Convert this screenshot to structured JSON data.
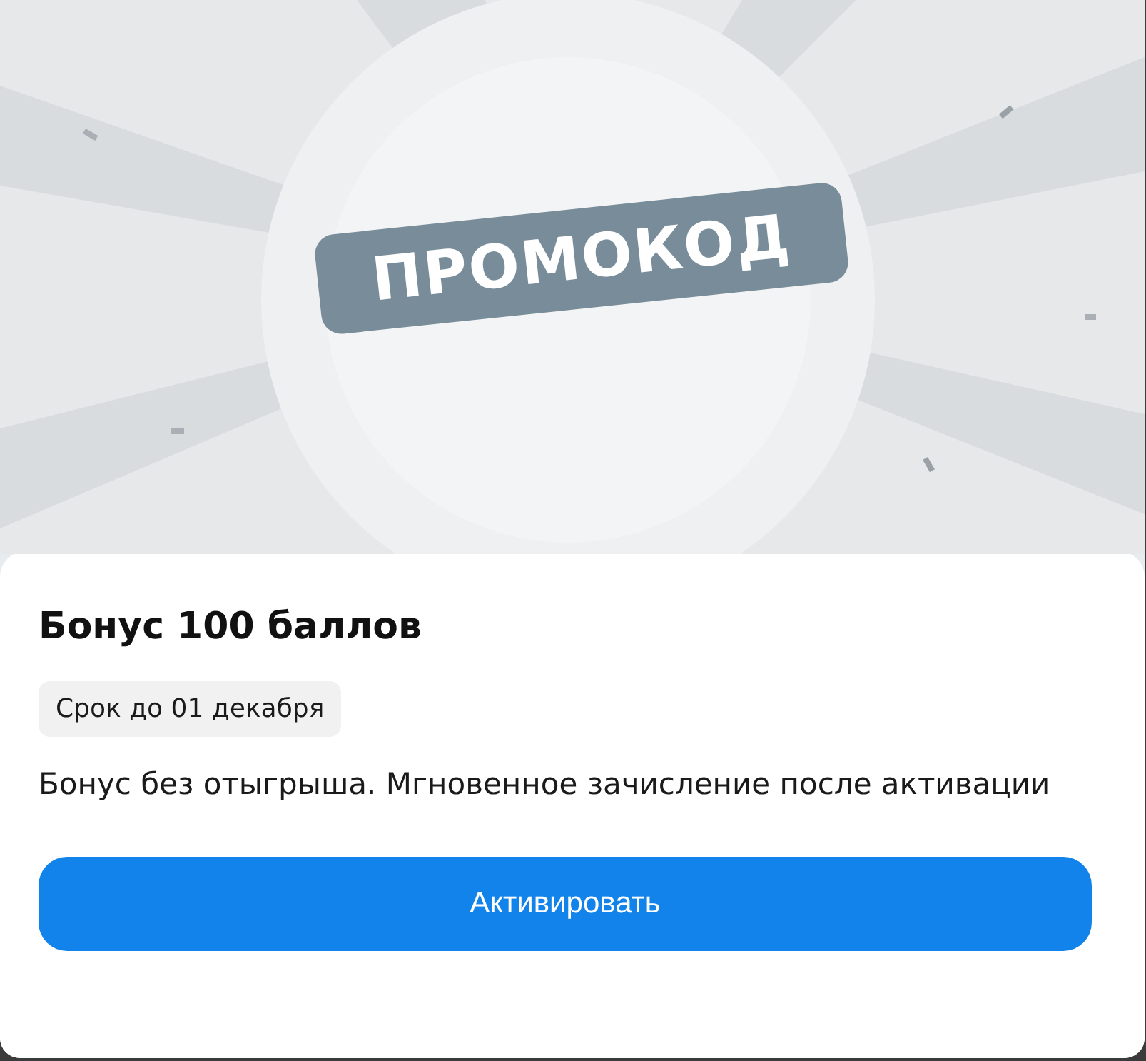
{
  "banner": {
    "kind": "picture",
    "badge": "ПРОМОКОД"
  },
  "offer": {
    "title": "Бонус 100 баллов",
    "expiry": "Срок до 01 декабря",
    "description": "Бонус без отыгрыша. Мгновенное зачисление после активации"
  },
  "action_button": "Активировать"
}
